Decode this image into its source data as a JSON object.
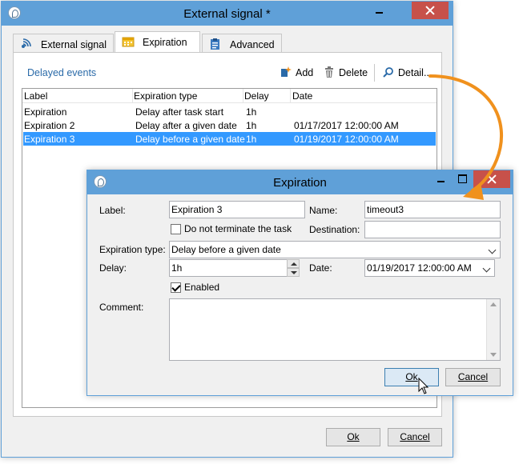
{
  "main_window": {
    "title": "External signal *",
    "tabs": [
      {
        "label": "External signal",
        "icon": "external-signal-icon"
      },
      {
        "label": "Expiration",
        "icon": "calendar-icon"
      },
      {
        "label": "Advanced",
        "icon": "clipboard-icon"
      }
    ],
    "active_tab": "Expiration",
    "section_title": "Delayed events",
    "toolbar": {
      "add_label": "Add",
      "delete_label": "Delete",
      "detail_label": "Detail..."
    },
    "table": {
      "columns": [
        "Label",
        "Expiration type",
        "Delay",
        "Date"
      ],
      "rows": [
        {
          "label": "Expiration",
          "type": "Delay after task start",
          "delay": "1h",
          "date": ""
        },
        {
          "label": "Expiration 2",
          "type": "Delay after a given date",
          "delay": "1h",
          "date": "01/17/2017 12:00:00 AM"
        },
        {
          "label": "Expiration 3",
          "type": "Delay before a given date",
          "delay": "1h",
          "date": "01/19/2017 12:00:00 AM",
          "selected": true
        }
      ]
    },
    "ok_label": "Ok",
    "cancel_label": "Cancel"
  },
  "dialog": {
    "title": "Expiration",
    "label_label": "Label:",
    "label_value": "Expiration 3",
    "name_label": "Name:",
    "name_value": "timeout3",
    "do_not_terminate_label": "Do not terminate the task",
    "do_not_terminate_checked": false,
    "destination_label": "Destination:",
    "destination_value": "",
    "expiration_type_label": "Expiration type:",
    "expiration_type_value": "Delay before a given date",
    "delay_label": "Delay:",
    "delay_value": "1h",
    "date_label": "Date:",
    "date_value": "01/19/2017 12:00:00 AM",
    "enabled_label": "Enabled",
    "enabled_checked": true,
    "comment_label": "Comment:",
    "comment_value": "",
    "ok_label": "Ok",
    "cancel_label": "Cancel"
  },
  "colors": {
    "titlebar": "#5fa0d8",
    "close_button": "#c7514a",
    "selection": "#3399ff",
    "arrow": "#f0911d",
    "section_title": "#2a6aa8"
  }
}
